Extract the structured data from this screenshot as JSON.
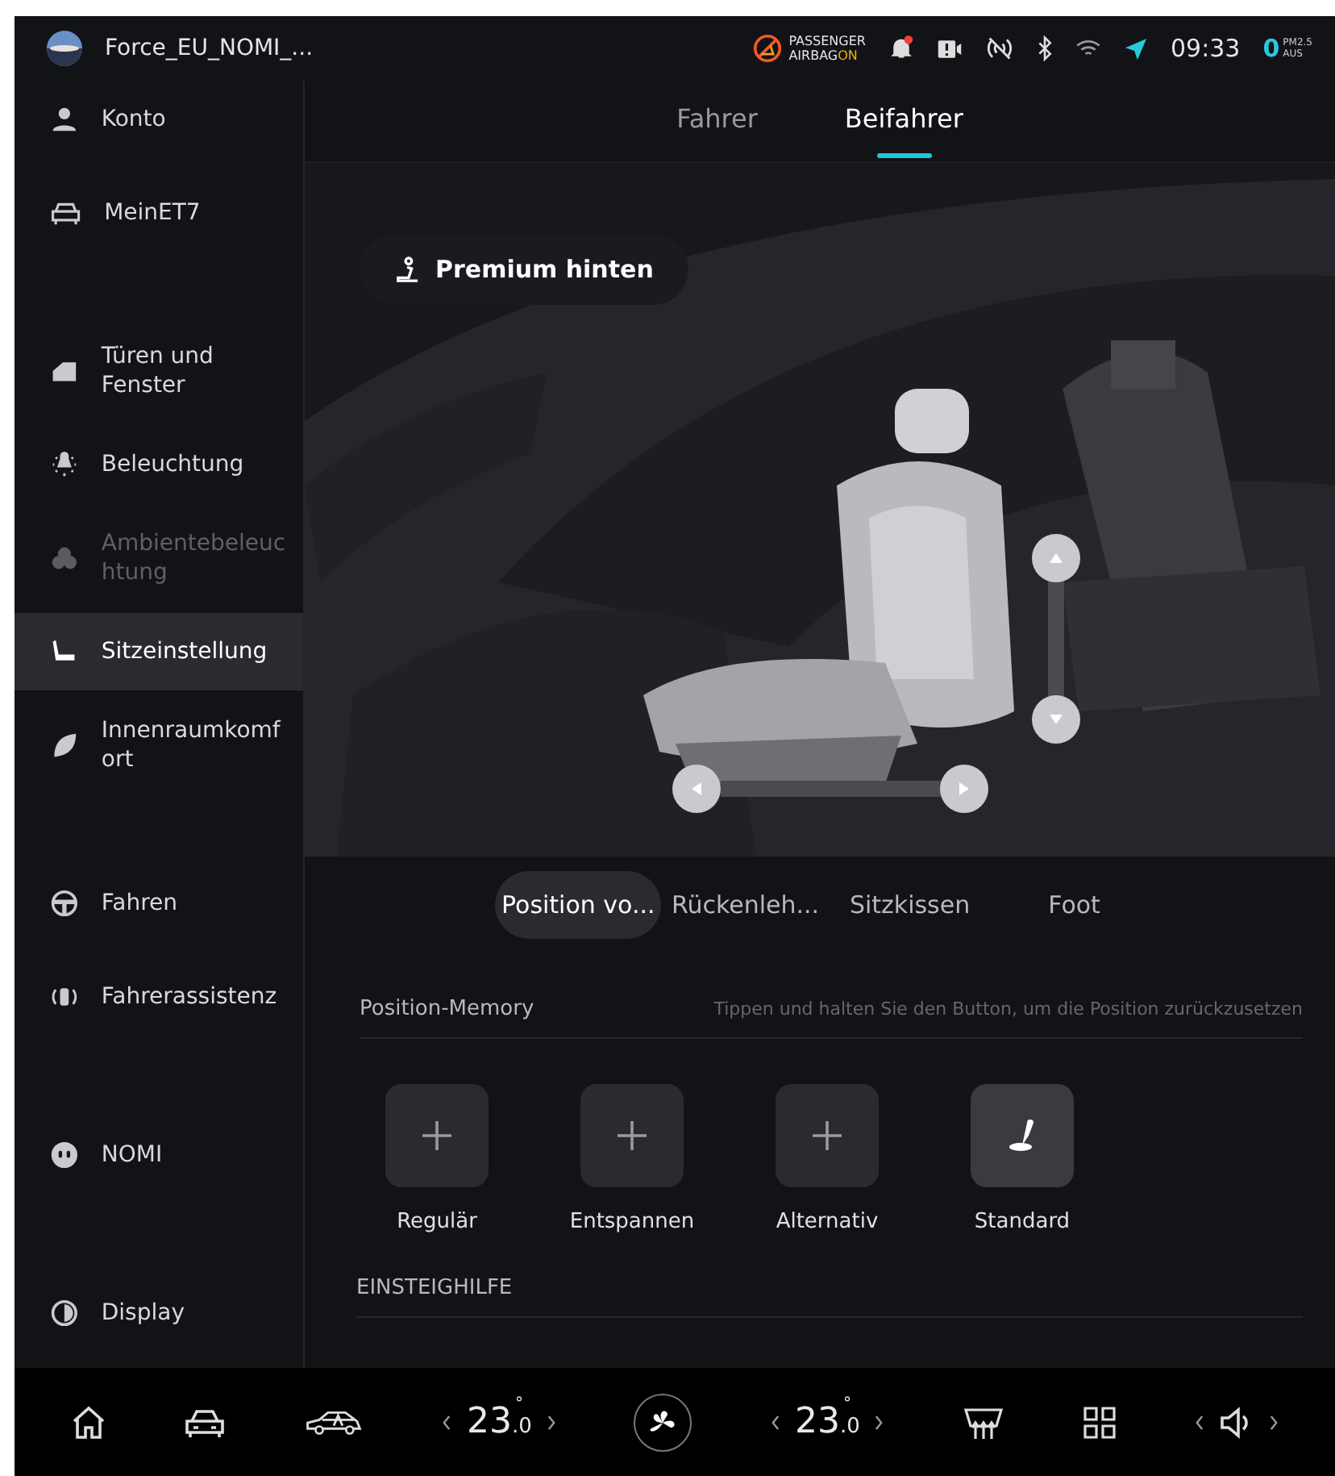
{
  "status_bar": {
    "profile_name": "Force_EU_NOMI_...",
    "airbag": {
      "line1": "PASSENGER",
      "line2": "AIRBAG",
      "state": "ON"
    },
    "time": "09:33",
    "air_quality": {
      "value": "0",
      "label": "PM2.5",
      "status": "AUS"
    }
  },
  "sidebar": {
    "groups": [
      {
        "items": [
          {
            "label": "Konto",
            "selected": false,
            "disabled": false
          },
          {
            "label": "MeinET7",
            "selected": false,
            "disabled": false
          }
        ]
      },
      {
        "items": [
          {
            "label": "Türen und Fenster",
            "selected": false,
            "disabled": false
          },
          {
            "label": "Beleuchtung",
            "selected": false,
            "disabled": false
          },
          {
            "label": "Ambientebeleuchtung",
            "selected": false,
            "disabled": true
          },
          {
            "label": "Sitzeinstellung",
            "selected": true,
            "disabled": false
          },
          {
            "label": "Innenraumkomfort",
            "selected": false,
            "disabled": false
          }
        ]
      },
      {
        "items": [
          {
            "label": "Fahren",
            "selected": false,
            "disabled": false
          },
          {
            "label": "Fahrerassistenz",
            "selected": false,
            "disabled": false
          }
        ]
      },
      {
        "items": [
          {
            "label": "NOMI",
            "selected": false,
            "disabled": false
          }
        ]
      },
      {
        "items": [
          {
            "label": "Display",
            "selected": false,
            "disabled": false
          }
        ]
      }
    ]
  },
  "tabs": [
    {
      "label": "Fahrer",
      "selected": false
    },
    {
      "label": "Beifahrer",
      "selected": true
    }
  ],
  "seat_view": {
    "kind": "picture",
    "mode_button": "Premium hinten"
  },
  "segments": [
    {
      "label": "Position vo...",
      "selected": true
    },
    {
      "label": "Rückenleh...",
      "selected": false
    },
    {
      "label": "Sitzkissen",
      "selected": false
    },
    {
      "label": "Foot",
      "selected": false
    }
  ],
  "memory": {
    "title": "Position-Memory",
    "hint": "Tippen und halten Sie den Button, um die Position zurückzusetzen",
    "slots": [
      {
        "label": "Regulär",
        "kind": "empty"
      },
      {
        "label": "Entspannen",
        "kind": "empty"
      },
      {
        "label": "Alternativ",
        "kind": "empty"
      },
      {
        "label": "Standard",
        "kind": "seat"
      }
    ]
  },
  "section_title": "EINSTEIGHILFE",
  "dock": {
    "left_temp": {
      "value": "23",
      "decimal": ".0",
      "unit": "°"
    },
    "right_temp": {
      "value": "23",
      "decimal": ".0",
      "unit": "°"
    }
  }
}
